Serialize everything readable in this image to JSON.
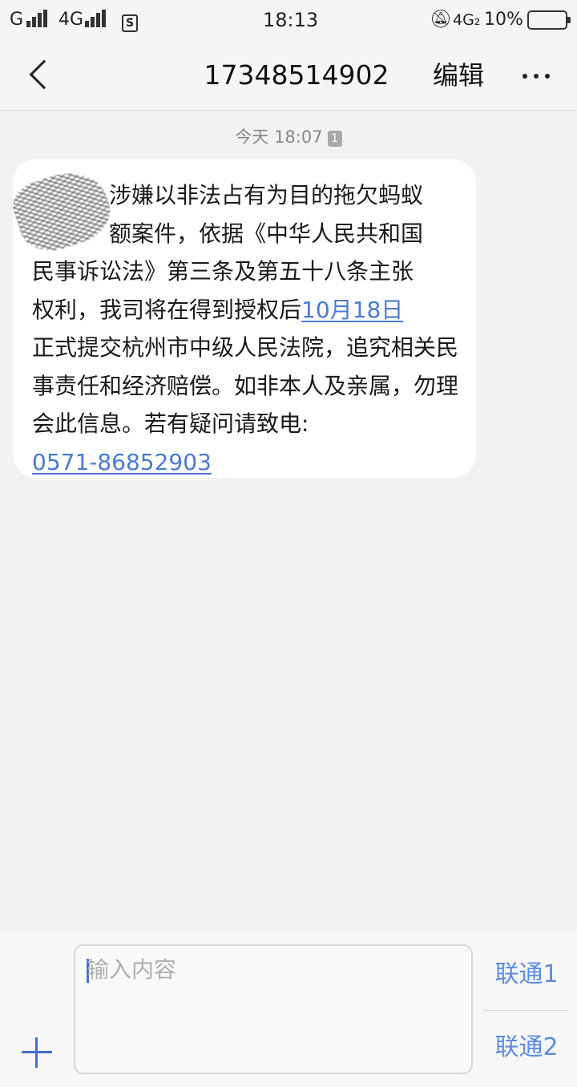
{
  "status_bar": {
    "carrier1": "G",
    "carrier2": "4G",
    "time": "18:13",
    "network_right": "4G₂",
    "battery": "10%",
    "sim_icon": "S"
  },
  "nav": {
    "title": "17348514902",
    "edit_label": "编辑",
    "back_icon": "chevron-left-icon",
    "more_icon": "more-horizontal-icon"
  },
  "thread": {
    "timestamp": "今天 18:07",
    "sim_badge": "1"
  },
  "message": {
    "line1": "涉嫌以非法占有为目的拖欠蚂蚁",
    "line2": "额案件，依据《中华人民共和国",
    "line3": "民事诉讼法》第三条及第五十八条主张",
    "text_before_date": "权利，我司将在得到授权后",
    "date_link": "10月18日",
    "text_after_date": "正式提交杭州市中级人民法院，追究相关民事责任和经济赔偿。如非本人及亲属，勿理会此信息。若有疑问请致电:",
    "phone_link": "0571-86852903"
  },
  "composer": {
    "placeholder": "输入内容",
    "send1_label": "联通1",
    "send2_label": "联通2",
    "add_icon": "plus-icon"
  },
  "colors": {
    "accent": "#4a79d4",
    "background": "#f2f2f2",
    "bubble": "#ffffff"
  }
}
